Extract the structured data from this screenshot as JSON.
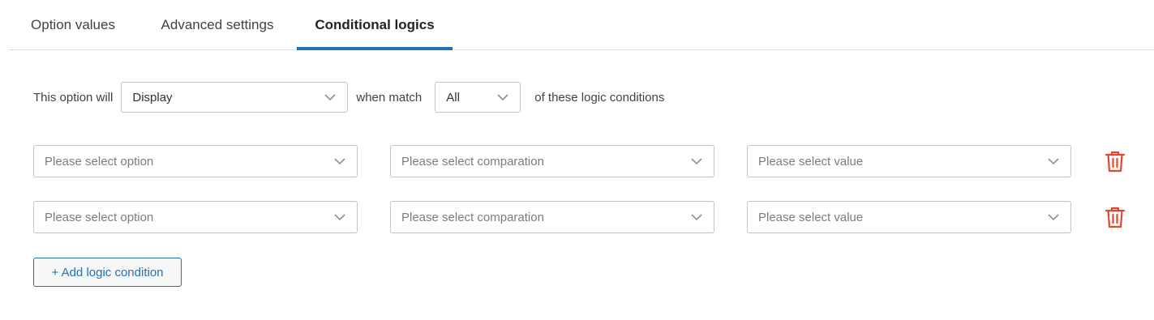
{
  "tabs": [
    {
      "label": "Option values",
      "active": false
    },
    {
      "label": "Advanced settings",
      "active": false
    },
    {
      "label": "Conditional logics",
      "active": true
    }
  ],
  "rule": {
    "prefix": "This option will",
    "action_value": "Display",
    "middle": "when match",
    "match_value": "All",
    "suffix": "of these logic conditions"
  },
  "conditions": [
    {
      "option_placeholder": "Please select option",
      "comparation_placeholder": "Please select comparation",
      "value_placeholder": "Please select value"
    },
    {
      "option_placeholder": "Please select option",
      "comparation_placeholder": "Please select comparation",
      "value_placeholder": "Please select value"
    }
  ],
  "add_button_label": "+ Add logic condition",
  "colors": {
    "accent": "#2271b1",
    "delete": "#e2462f",
    "border": "#c3c4c7"
  },
  "icons": {
    "dropdown": "chevron-down-icon",
    "delete": "trash-icon"
  }
}
